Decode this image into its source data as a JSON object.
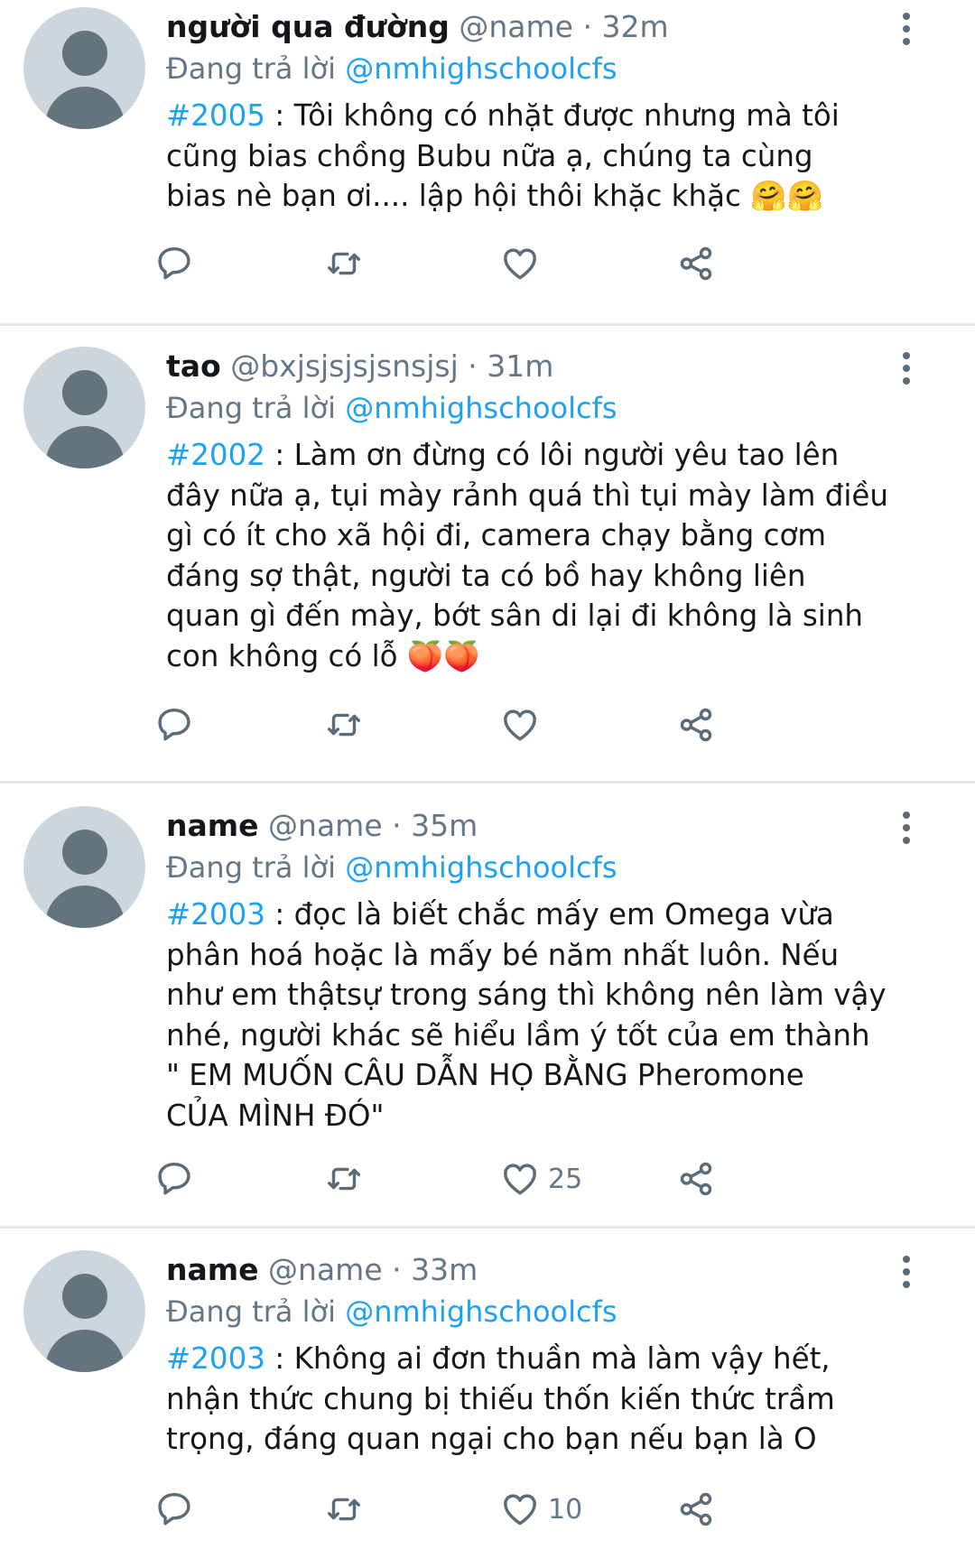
{
  "tweets": [
    {
      "display_name": "người qua đường",
      "handle": "@name",
      "sep": "·",
      "time": "32m",
      "reply_prefix": "Đang trả lời",
      "reply_to": "@nmhighschoolcfs",
      "hashtag": "#2005",
      "text": " : Tôi không có nhặt được nhưng mà tôi\ncũng bias chồng Bubu nữa ạ, chúng ta cùng\nbias nè bạn ơi.... lập hội thôi khặc khặc 🤗🤗",
      "like_count": ""
    },
    {
      "display_name": "tao",
      "handle": "@bxjsjsjsjsnsjsj",
      "sep": "·",
      "time": "31m",
      "reply_prefix": "Đang trả lời",
      "reply_to": "@nmhighschoolcfs",
      "hashtag": "#2002",
      "text": " : Làm ơn đừng có lôi người yêu tao lên\nđây nữa ạ, tụi mày rảnh quá thì tụi mày làm điều\ngì có ít cho xã hội đi, camera chạy bằng cơm\nđáng sợ thật, người ta có bồ hay không liên\nquan gì đến mày, bớt sân di lại đi không là sinh\ncon không có lỗ 🍑🍑",
      "like_count": ""
    },
    {
      "display_name": "name",
      "handle": "@name",
      "sep": "·",
      "time": "35m",
      "reply_prefix": "Đang trả lời",
      "reply_to": "@nmhighschoolcfs",
      "hashtag": "#2003",
      "text": " : đọc là biết chắc mấy em Omega vừa\nphân hoá hoặc là mấy bé năm nhất luôn. Nếu\nnhư em thậtsự trong sáng thì không nên làm vậy\nnhé, người khác sẽ hiểu lầm ý tốt của em thành\n\" EM MUỐN CÂU DẪN HỌ BẰNG  Pheromone\nCỦA MÌNH ĐÓ\"",
      "like_count": "25"
    },
    {
      "display_name": "name",
      "handle": "@name",
      "sep": "·",
      "time": "33m",
      "reply_prefix": "Đang trả lời",
      "reply_to": "@nmhighschoolcfs",
      "hashtag": "#2003",
      "text": " : Không ai đơn thuần mà làm vậy hết,\nnhận thức chung bị thiếu thốn kiến thức trầm\ntrọng, đáng quan ngại cho bạn nếu bạn là O",
      "like_count": "10"
    }
  ],
  "icons": {
    "reply": "reply-icon",
    "retweet": "retweet-icon",
    "like": "heart-icon",
    "share": "share-icon",
    "more": "more-vertical-icon"
  },
  "colors": {
    "link": "#1da1f2",
    "muted": "#657786",
    "text": "#14171a",
    "avatar_bg": "#ccd6dd",
    "avatar_fg": "#63747d",
    "divider": "#e6e9ec"
  }
}
